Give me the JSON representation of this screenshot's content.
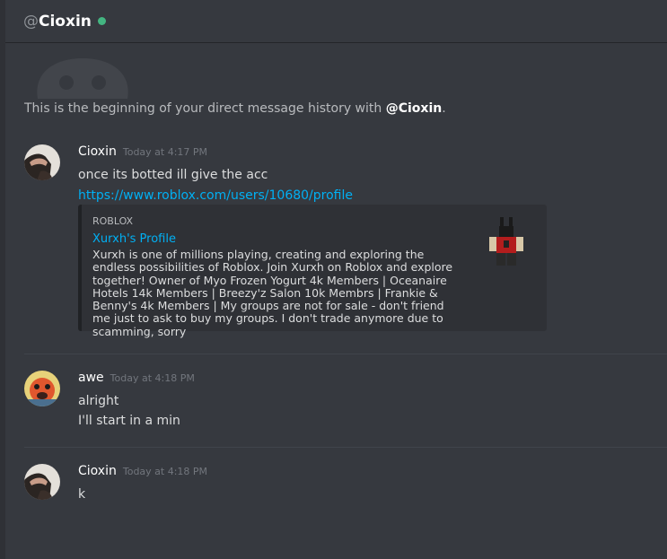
{
  "header": {
    "at_symbol": "@",
    "username": "Cioxin",
    "status_color": "#43b581"
  },
  "intro": {
    "text": "This is the beginning of your direct message history with ",
    "mention": "@Cioxin",
    "end": "."
  },
  "messages": [
    {
      "author": "Cioxin",
      "timestamp": "Today at 4:17 PM",
      "lines": [
        "once its botted ill give the acc"
      ],
      "link": "https://www.roblox.com/users/10680/profile",
      "embed": {
        "provider": "ROBLOX",
        "title": "Xurxh's Profile",
        "description": "Xurxh is one of millions playing, creating and exploring the endless possibilities of Roblox. Join Xurxh on Roblox and explore together! Owner of Myo Frozen Yogurt 4k Members | Oceanaire Hotels 14k Members | Breezy'z Salon 10k Membrs | Frankie & Benny's 4k Members | My groups are not for sale - don't friend me just to ask to buy my groups. I don't trade anymore due to scamming, sorry",
        "thumbnail_icon": "roblox-avatar-thumbnail"
      }
    },
    {
      "author": "awe",
      "timestamp": "Today at 4:18 PM",
      "lines": [
        "alright",
        "I'll start in a min"
      ]
    },
    {
      "author": "Cioxin",
      "timestamp": "Today at 4:18 PM",
      "lines": [
        "k"
      ]
    }
  ]
}
